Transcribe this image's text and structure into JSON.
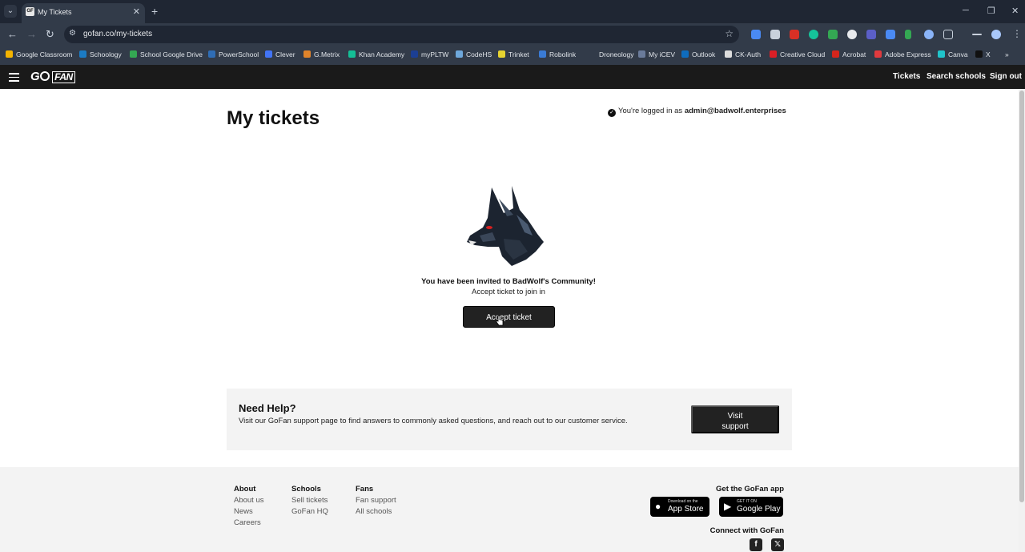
{
  "browser": {
    "tab_title": "My Tickets",
    "favicon_text": "GF",
    "url": "gofan.co/my-tickets",
    "bookmarks": [
      {
        "label": "Google Classroom",
        "color": "#f4b400"
      },
      {
        "label": "Schoology",
        "color": "#1b7bc4"
      },
      {
        "label": "School Google Drive",
        "color": "#34a853"
      },
      {
        "label": "PowerSchool",
        "color": "#2f6db5"
      },
      {
        "label": "Clever",
        "color": "#4274f6"
      },
      {
        "label": "G.Metrix",
        "color": "#e0842b"
      },
      {
        "label": "Khan Academy",
        "color": "#14bf96"
      },
      {
        "label": "myPLTW",
        "color": "#1c3f94"
      },
      {
        "label": "CodeHS",
        "color": "#6ea8dc"
      },
      {
        "label": "Trinket",
        "color": "#e6d330"
      },
      {
        "label": "Robolink",
        "color": "#3a7bd5"
      },
      {
        "label": "Droneology",
        "color": "#323b49"
      },
      {
        "label": "My iCEV",
        "color": "#6a7b9a"
      },
      {
        "label": "Outlook",
        "color": "#0f6cbd"
      },
      {
        "label": "CK-Auth",
        "color": "#dddddd"
      },
      {
        "label": "Creative Cloud",
        "color": "#da1f26"
      },
      {
        "label": "Acrobat",
        "color": "#d4251c"
      },
      {
        "label": "Adobe Express",
        "color": "#e03a3e"
      },
      {
        "label": "Canva",
        "color": "#20c4cb"
      },
      {
        "label": "X",
        "color": "#111111"
      }
    ]
  },
  "header": {
    "logo_go": "G",
    "logo_fan": "FAN",
    "nav": [
      "Tickets",
      "Search schools",
      "Sign out"
    ]
  },
  "main": {
    "title": "My tickets",
    "login_prefix": "You're logged in as ",
    "login_email": "admin@badwolf.enterprises",
    "invite_heading": "You have been invited to BadWolf's Community!",
    "invite_sub": "Accept ticket to join in",
    "accept_label": "Accept ticket"
  },
  "help": {
    "title": "Need Help?",
    "text": "Visit our GoFan support page to find answers to commonly asked questions, and reach out to our customer service.",
    "button_line1": "Visit",
    "button_line2": "support"
  },
  "footer": {
    "columns": [
      {
        "heading": "About",
        "links": [
          "About us",
          "News",
          "Careers"
        ]
      },
      {
        "heading": "Schools",
        "links": [
          "Sell tickets",
          "GoFan HQ"
        ]
      },
      {
        "heading": "Fans",
        "links": [
          "Fan support",
          "All schools"
        ]
      }
    ],
    "app_title": "Get the GoFan app",
    "app_store_small": "Download on the",
    "app_store_large": "App Store",
    "google_play_small": "GET IT ON",
    "google_play_large": "Google Play",
    "connect_title": "Connect with GoFan"
  }
}
